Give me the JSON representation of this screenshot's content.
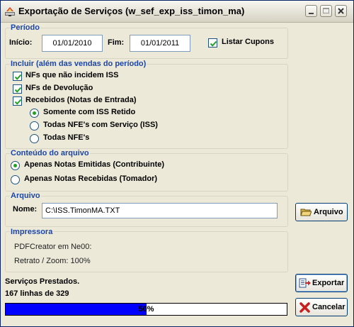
{
  "window": {
    "title": "Exportação de Serviços (w_sef_exp_iss_timon_ma)"
  },
  "periodo": {
    "legend": "Período",
    "inicio_label": "Início:",
    "inicio_value": "01/01/2010",
    "fim_label": "Fim:",
    "fim_value": "01/01/2011",
    "listar_cupons_label": "Listar Cupons",
    "listar_cupons_checked": true
  },
  "incluir": {
    "legend": "Incluir (além das vendas do período)",
    "items": [
      {
        "label": "NFs que não incidem ISS",
        "checked": true
      },
      {
        "label": "NFs de Devolução",
        "checked": true
      },
      {
        "label": "Recebidos (Notas de Entrada)",
        "checked": true
      }
    ],
    "recebidos_options": [
      {
        "label": "Somente com ISS Retido",
        "selected": true
      },
      {
        "label": "Todas NFE's com Serviço (ISS)",
        "selected": false
      },
      {
        "label": "Todas NFE's",
        "selected": false
      }
    ]
  },
  "conteudo": {
    "legend": "Conteúdo do arquivo",
    "options": [
      {
        "label": "Apenas Notas Emitidas (Contribuinte)",
        "selected": true
      },
      {
        "label": "Apenas Notas Recebidas (Tomador)",
        "selected": false
      }
    ]
  },
  "arquivo": {
    "legend": "Arquivo",
    "nome_label": "Nome:",
    "nome_value": "C:\\ISS.TimonMA.TXT",
    "button_label": "Arquivo"
  },
  "impressora": {
    "legend": "Impressora",
    "printer": "PDFCreator em Ne00:",
    "zoom": "Retrato / Zoom: 100%"
  },
  "status": {
    "line1": "Serviços Prestados.",
    "line2": "167 linhas de 329",
    "progress_text": "50%",
    "progress_fraction": 0.5
  },
  "buttons": {
    "exportar": "Exportar",
    "cancelar": "Cancelar"
  },
  "colors": {
    "legend": "#1c45a8",
    "progress": "#0000ff",
    "radio_dot": "#21a121"
  }
}
